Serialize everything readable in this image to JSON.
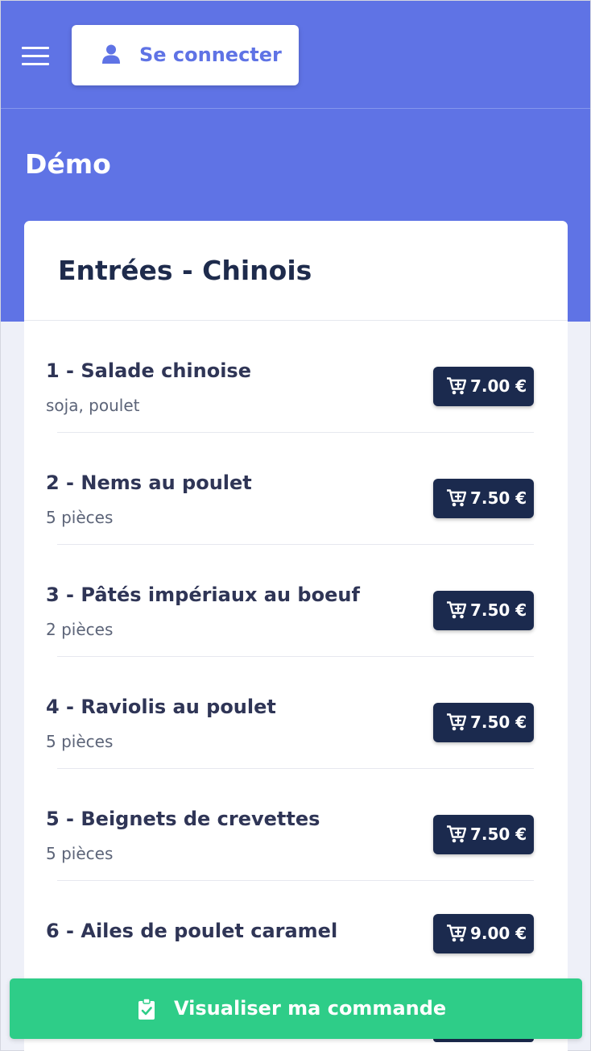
{
  "header": {
    "login_label": "Se connecter",
    "page_title": "Démo",
    "brand_color": "#5f73e5"
  },
  "menu": {
    "section_title": "Entrées - Chinois",
    "items": [
      {
        "number": "1",
        "sep": " - ",
        "name": "Salade chinoise",
        "desc": "soja, poulet",
        "price": "7.00 €"
      },
      {
        "number": "2",
        "sep": " - ",
        "name": "Nems au poulet",
        "desc": "5 pièces",
        "price": "7.50 €"
      },
      {
        "number": "3",
        "sep": " - ",
        "name": "Pâtés impériaux au boeuf",
        "desc": "2 pièces",
        "price": "7.50 €"
      },
      {
        "number": "4",
        "sep": " - ",
        "name": "Raviolis au poulet",
        "desc": "5 pièces",
        "price": "7.50 €"
      },
      {
        "number": "5",
        "sep": " - ",
        "name": "Beignets de crevettes",
        "desc": "5 pièces",
        "price": "7.50 €"
      },
      {
        "number": "6",
        "sep": " - ",
        "name": "Ailes de poulet caramel",
        "desc": "",
        "price": "9.00 €"
      }
    ]
  },
  "footer": {
    "order_label": "Visualiser ma commande",
    "order_color": "#2ecd88"
  },
  "icons": {
    "menu": "hamburger-icon",
    "user": "user-icon",
    "cart": "cart-plus-icon",
    "order": "clipboard-check-icon"
  }
}
